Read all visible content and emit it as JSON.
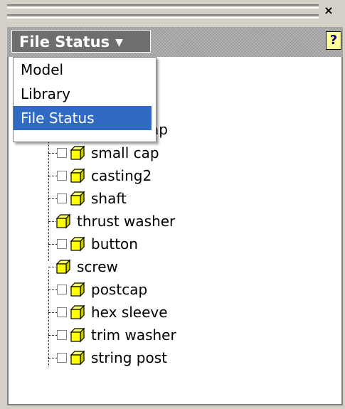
{
  "toolbar": {
    "close_glyph": "×",
    "help_glyph": "?"
  },
  "dropdown": {
    "label": "File Status",
    "caret": "▼"
  },
  "menu": {
    "items": [
      {
        "label": "Model",
        "selected": false
      },
      {
        "label": "Library",
        "selected": false
      },
      {
        "label": "File Status",
        "selected": true
      }
    ]
  },
  "tree": {
    "partial_item": "cap",
    "items": [
      {
        "label": "small cap",
        "level": 2,
        "checkbox": true
      },
      {
        "label": "casting2",
        "level": 2,
        "checkbox": true
      },
      {
        "label": "shaft",
        "level": 2,
        "checkbox": true
      },
      {
        "label": "thrust washer",
        "level": 1,
        "checkbox": false
      },
      {
        "label": "button",
        "level": 2,
        "checkbox": true
      },
      {
        "label": "screw",
        "level": 1,
        "checkbox": false
      },
      {
        "label": "postcap",
        "level": 2,
        "checkbox": true
      },
      {
        "label": "hex sleeve",
        "level": 2,
        "checkbox": true
      },
      {
        "label": "trim washer",
        "level": 2,
        "checkbox": true
      },
      {
        "label": "string post",
        "level": 2,
        "checkbox": true
      }
    ]
  },
  "colors": {
    "selection": "#316ac5",
    "part_icon": "#ffff00",
    "panel": "#ffffff"
  }
}
